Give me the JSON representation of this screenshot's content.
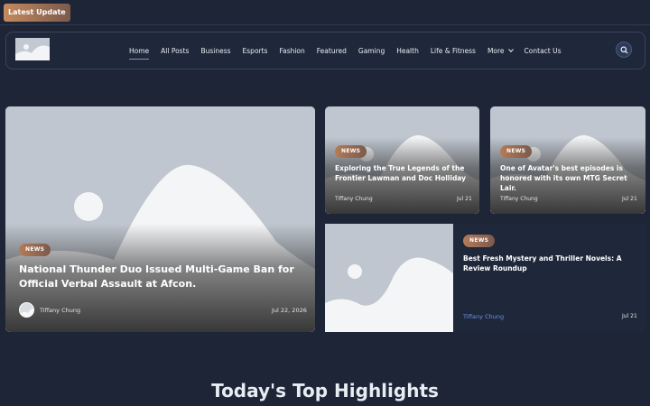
{
  "topbar": {
    "latest_label": "Latest  Update"
  },
  "nav": {
    "items": [
      {
        "label": "Home"
      },
      {
        "label": "All Posts"
      },
      {
        "label": "Business"
      },
      {
        "label": "Esports"
      },
      {
        "label": "Fashion"
      },
      {
        "label": "Featured"
      },
      {
        "label": "Gaming"
      },
      {
        "label": "Health"
      },
      {
        "label": "Life & Fitness"
      },
      {
        "label": "More"
      },
      {
        "label": "Contact Us"
      }
    ]
  },
  "search": {
    "icon": "search-icon"
  },
  "posts": [
    {
      "category": "NEWS",
      "title": "National Thunder Duo Issued Multi-Game Ban for Official Verbal Assault at Afcon.",
      "author": "Tiffany Chung",
      "date": "Jul 22, 2026"
    },
    {
      "category": "NEWS",
      "title": "Exploring the True Legends of the Frontier Lawman and Doc Holliday",
      "author": "Tiffany Chung",
      "date": "Jul 21"
    },
    {
      "category": "NEWS",
      "title": "One of Avatar's best episodes is honored with its own MTG Secret Lair.",
      "author": "Tiffany Chung",
      "date": "Jul 21"
    },
    {
      "category": "NEWS",
      "title": "Best Fresh Mystery and Thriller Novels: A Review Roundup",
      "author": "Tiffany Chung",
      "date": "Jul 21"
    }
  ],
  "section": {
    "heading": "Today's Top Highlights"
  },
  "colors": {
    "background": "#1d2536",
    "badge": "#b57b57",
    "author_link": "#6f8fe8"
  }
}
